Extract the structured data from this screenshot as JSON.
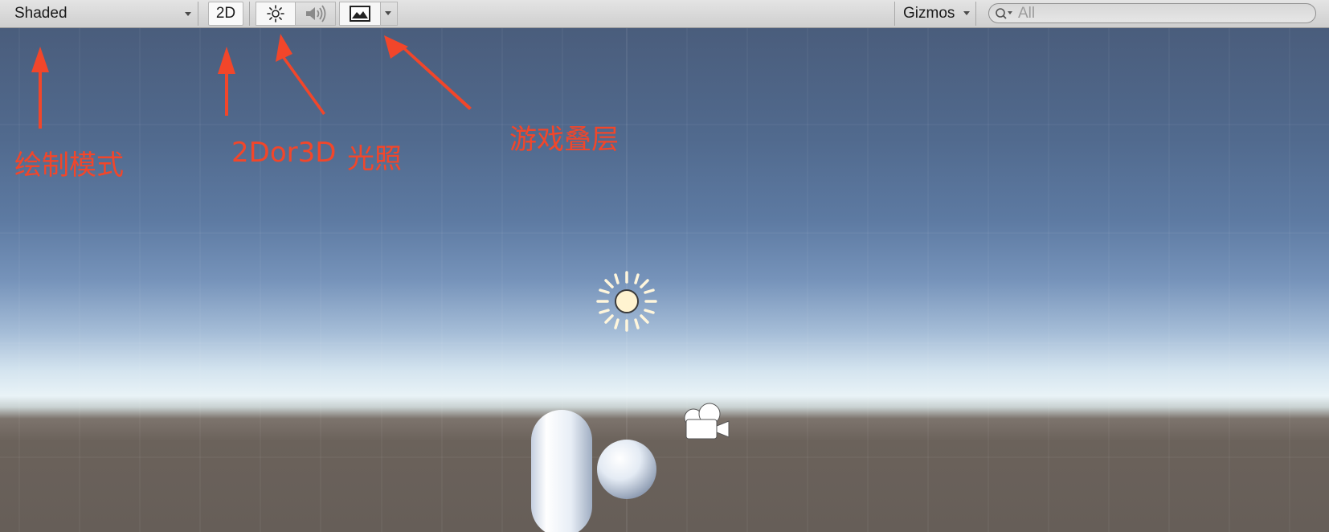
{
  "toolbar": {
    "draw_mode_label": "Shaded",
    "mode_2d_label": "2D",
    "gizmos_label": "Gizmos",
    "search_placeholder": "All",
    "icons": {
      "lighting": "sun-icon",
      "audio": "speaker-icon",
      "effects": "image-icon",
      "search": "search-icon"
    }
  },
  "annotations": {
    "draw_mode": "绘制模式",
    "mode_2d_or_3d": "2Dor3D",
    "lighting": "光照",
    "game_overlay": "游戏叠层"
  },
  "colors": {
    "annotation": "#f2462a",
    "sky_top": "#4a5d7c",
    "horizon": "#e9f3f7",
    "ground": "#665e58"
  },
  "scene": {
    "objects": [
      "directional-light-icon",
      "camera-icon",
      "capsule",
      "sphere"
    ]
  }
}
